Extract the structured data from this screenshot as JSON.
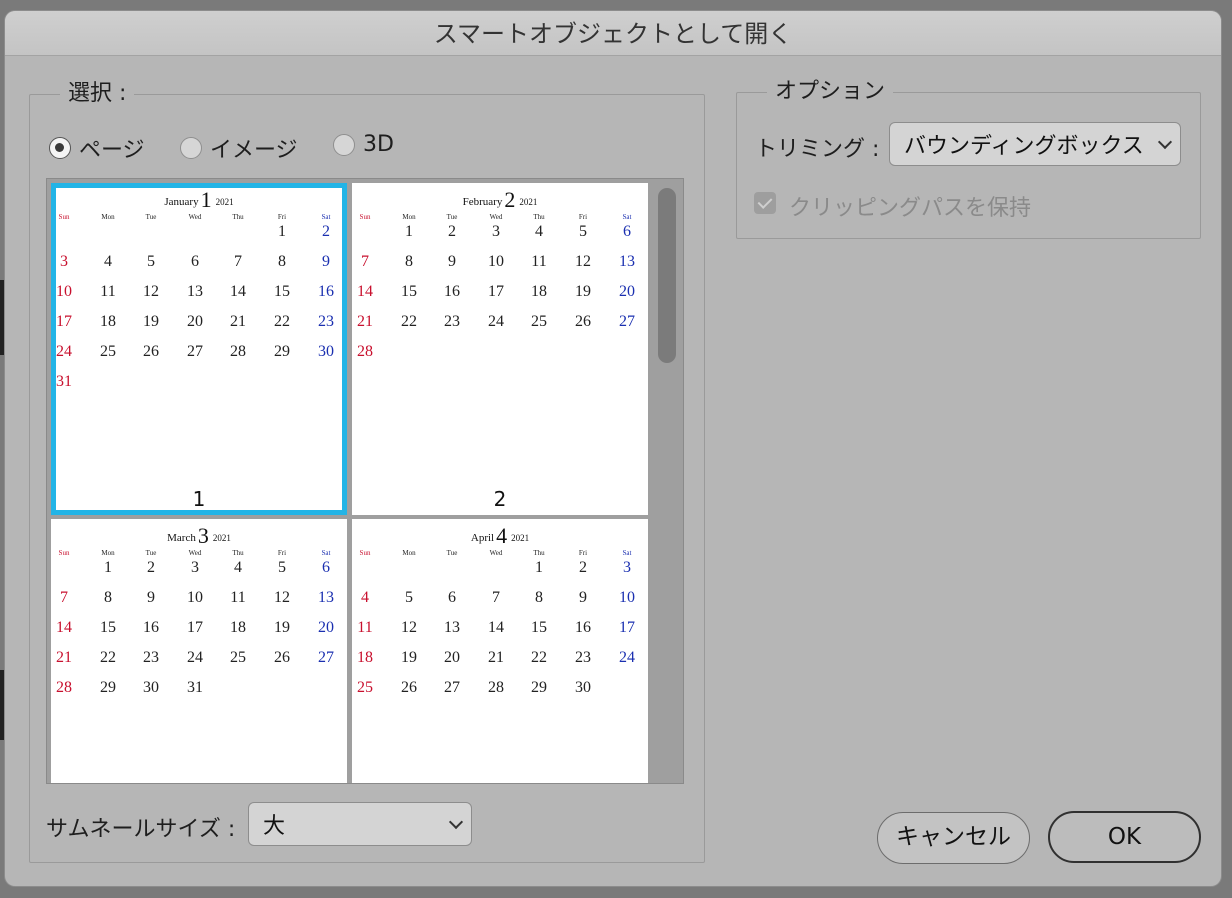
{
  "dialog": {
    "title": "スマートオブジェクトとして開く"
  },
  "selection": {
    "legend": "選択 :",
    "options": [
      {
        "label": "ページ",
        "selected": true
      },
      {
        "label": "イメージ",
        "selected": false
      },
      {
        "label": "3D",
        "selected": false
      }
    ]
  },
  "thumbnails": {
    "pages": [
      {
        "label": "1",
        "month": "January",
        "number": "1",
        "year": "2021",
        "selected": true,
        "weekdays": [
          "Sun",
          "Mon",
          "Tue",
          "Wed",
          "Thu",
          "Fri",
          "Sat"
        ],
        "weeks": [
          [
            "",
            "",
            "",
            "",
            "",
            "1",
            "2"
          ],
          [
            "3",
            "4",
            "5",
            "6",
            "7",
            "8",
            "9"
          ],
          [
            "10",
            "11",
            "12",
            "13",
            "14",
            "15",
            "16"
          ],
          [
            "17",
            "18",
            "19",
            "20",
            "21",
            "22",
            "23"
          ],
          [
            "24",
            "25",
            "26",
            "27",
            "28",
            "29",
            "30"
          ],
          [
            "31",
            "",
            "",
            "",
            "",
            "",
            ""
          ]
        ]
      },
      {
        "label": "2",
        "month": "February",
        "number": "2",
        "year": "2021",
        "selected": false,
        "weekdays": [
          "Sun",
          "Mon",
          "Tue",
          "Wed",
          "Thu",
          "Fri",
          "Sat"
        ],
        "weeks": [
          [
            "",
            "1",
            "2",
            "3",
            "4",
            "5",
            "6"
          ],
          [
            "7",
            "8",
            "9",
            "10",
            "11",
            "12",
            "13"
          ],
          [
            "14",
            "15",
            "16",
            "17",
            "18",
            "19",
            "20"
          ],
          [
            "21",
            "22",
            "23",
            "24",
            "25",
            "26",
            "27"
          ],
          [
            "28",
            "",
            "",
            "",
            "",
            "",
            ""
          ]
        ]
      },
      {
        "label": "",
        "month": "March",
        "number": "3",
        "year": "2021",
        "selected": false,
        "weekdays": [
          "Sun",
          "Mon",
          "Tue",
          "Wed",
          "Thu",
          "Fri",
          "Sat"
        ],
        "weeks": [
          [
            "",
            "1",
            "2",
            "3",
            "4",
            "5",
            "6"
          ],
          [
            "7",
            "8",
            "9",
            "10",
            "11",
            "12",
            "13"
          ],
          [
            "14",
            "15",
            "16",
            "17",
            "18",
            "19",
            "20"
          ],
          [
            "21",
            "22",
            "23",
            "24",
            "25",
            "26",
            "27"
          ],
          [
            "28",
            "29",
            "30",
            "31",
            "",
            "",
            ""
          ]
        ]
      },
      {
        "label": "",
        "month": "April",
        "number": "4",
        "year": "2021",
        "selected": false,
        "weekdays": [
          "Sun",
          "Mon",
          "Tue",
          "Wed",
          "Thu",
          "Fri",
          "Sat"
        ],
        "weeks": [
          [
            "",
            "",
            "",
            "",
            "1",
            "2",
            "3"
          ],
          [
            "4",
            "5",
            "6",
            "7",
            "8",
            "9",
            "10"
          ],
          [
            "11",
            "12",
            "13",
            "14",
            "15",
            "16",
            "17"
          ],
          [
            "18",
            "19",
            "20",
            "21",
            "22",
            "23",
            "24"
          ],
          [
            "25",
            "26",
            "27",
            "28",
            "29",
            "30",
            ""
          ]
        ]
      }
    ]
  },
  "thumbnail_size": {
    "label": "サムネールサイズ :",
    "value": "大"
  },
  "options": {
    "legend": "オプション",
    "crop_label": "トリミング :",
    "crop_value": "バウンディングボックス",
    "clipping_label": "クリッピングパスを保持",
    "clipping_checked": true
  },
  "buttons": {
    "cancel": "キャンセル",
    "ok": "OK"
  },
  "colors": {
    "selection_border": "#23b4e6",
    "sunday": "#c8102e",
    "saturday": "#1a2fb0"
  }
}
